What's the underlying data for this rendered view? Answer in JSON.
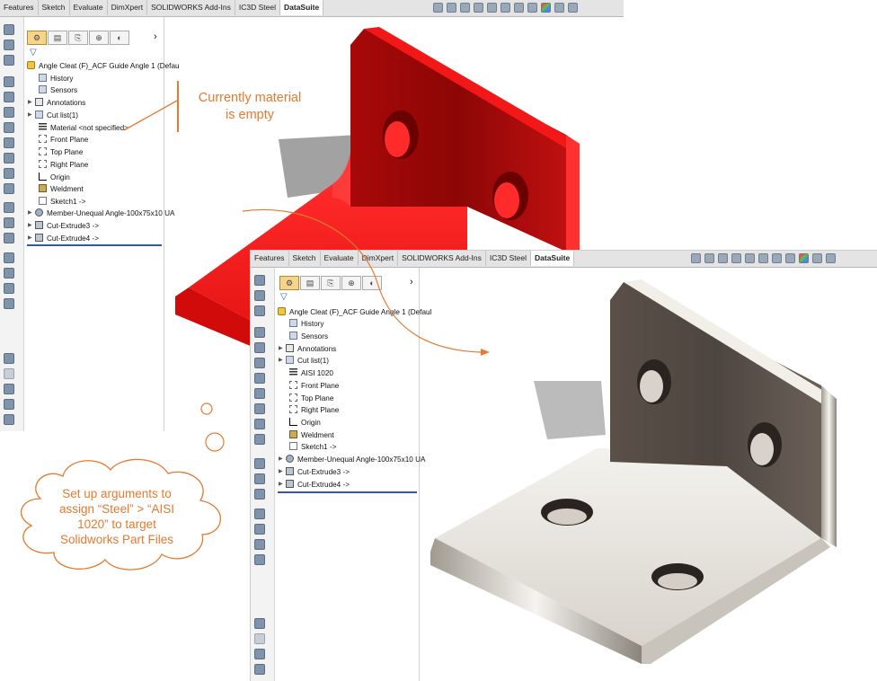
{
  "window_top": {
    "tabs": [
      "Features",
      "Sketch",
      "Evaluate",
      "DimXpert",
      "SOLIDWORKS Add-Ins",
      "IC3D Steel",
      "DataSuite"
    ],
    "active_tab": "DataSuite",
    "tree": [
      {
        "label": "Angle Cleat (F)_ACF Guide Angle 1  (Defau",
        "icon": "part-icon"
      },
      {
        "label": "History",
        "icon": "history-icon"
      },
      {
        "label": "Sensors",
        "icon": "sensors-icon"
      },
      {
        "label": "Annotations",
        "icon": "annotations-icon"
      },
      {
        "label": "Cut list(1)",
        "icon": "cut-list-icon"
      },
      {
        "label": "Material <not specified>",
        "icon": "material-icon"
      },
      {
        "label": "Front Plane",
        "icon": "plane-icon"
      },
      {
        "label": "Top Plane",
        "icon": "plane-icon"
      },
      {
        "label": "Right Plane",
        "icon": "plane-icon"
      },
      {
        "label": "Origin",
        "icon": "origin-icon"
      },
      {
        "label": "Weldment",
        "icon": "weldment-icon"
      },
      {
        "label": "Sketch1 ->",
        "icon": "sketch-icon"
      },
      {
        "label": "Member-Unequal Angle-100x75x10 UA",
        "icon": "structural-member-icon"
      },
      {
        "label": "Cut-Extrude3 ->",
        "icon": "cut-extrude-icon"
      },
      {
        "label": "Cut-Extrude4 ->",
        "icon": "cut-extrude-icon"
      }
    ]
  },
  "window_bottom": {
    "tabs": [
      "Features",
      "Sketch",
      "Evaluate",
      "DimXpert",
      "SOLIDWORKS Add-Ins",
      "IC3D Steel",
      "DataSuite"
    ],
    "active_tab": "DataSuite",
    "tree": [
      {
        "label": "Angle Cleat (F)_ACF Guide Angle 1  (Defaul",
        "icon": "part-icon"
      },
      {
        "label": "History",
        "icon": "history-icon"
      },
      {
        "label": "Sensors",
        "icon": "sensors-icon"
      },
      {
        "label": "Annotations",
        "icon": "annotations-icon"
      },
      {
        "label": "Cut list(1)",
        "icon": "cut-list-icon"
      },
      {
        "label": "AISI 1020",
        "icon": "material-icon"
      },
      {
        "label": "Front Plane",
        "icon": "plane-icon"
      },
      {
        "label": "Top Plane",
        "icon": "plane-icon"
      },
      {
        "label": "Right Plane",
        "icon": "plane-icon"
      },
      {
        "label": "Origin",
        "icon": "origin-icon"
      },
      {
        "label": "Weldment",
        "icon": "weldment-icon"
      },
      {
        "label": "Sketch1 ->",
        "icon": "sketch-icon"
      },
      {
        "label": "Member-Unequal Angle-100x75x10 UA",
        "icon": "structural-member-icon"
      },
      {
        "label": "Cut-Extrude3 ->",
        "icon": "cut-extrude-icon"
      },
      {
        "label": "Cut-Extrude4 ->",
        "icon": "cut-extrude-icon"
      }
    ]
  },
  "callout": {
    "line1": "Currently material",
    "line2": "is empty"
  },
  "cloud": {
    "line1": "Set up arguments to",
    "line2": "assign “Steel” > “AISI",
    "line3": "1020” to target",
    "line4": "Solidworks Part Files"
  },
  "colors": {
    "annotation": "#e37a2f",
    "part_red": "#e81212",
    "rollback_bar": "#2e58a8"
  }
}
